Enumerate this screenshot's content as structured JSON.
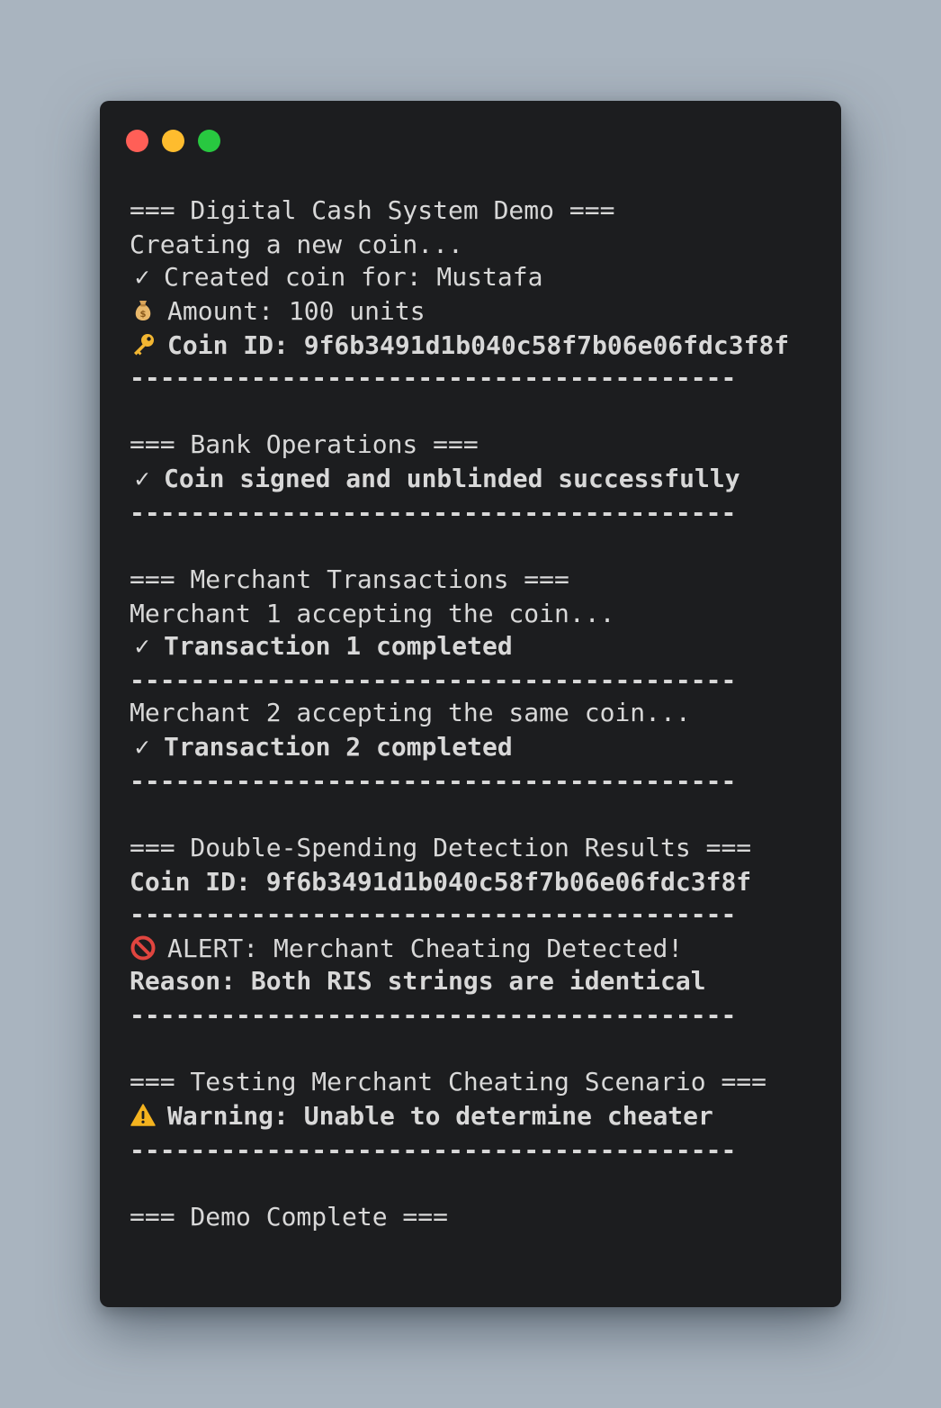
{
  "terminal": {
    "lines": {
      "header_demo": "=== Digital Cash System Demo ===",
      "creating": "Creating a new coin...",
      "created_coin": "Created coin for: Mustafa",
      "amount": "Amount: 100 units",
      "coin_id": "Coin ID: 9f6b3491d1b040c58f7b06e06fdc3f8f",
      "sep1": "----------------------------------------",
      "header_bank": "=== Bank Operations ===",
      "bank_result": "Coin signed and unblinded successfully",
      "sep2": "----------------------------------------",
      "header_merchant": "=== Merchant Transactions ===",
      "merchant1": "Merchant 1 accepting the coin...",
      "tx1": "Transaction 1 completed",
      "sep3": "----------------------------------------",
      "merchant2": "Merchant 2 accepting the same coin...",
      "tx2": "Transaction 2 completed",
      "sep4": "----------------------------------------",
      "header_detection": "=== Double-Spending Detection Results ===",
      "detect_coin_id": "Coin ID: 9f6b3491d1b040c58f7b06e06fdc3f8f",
      "sep5": "----------------------------------------",
      "alert": "ALERT: Merchant Cheating Detected!",
      "reason": "Reason: Both RIS strings are identical",
      "sep6": "----------------------------------------",
      "header_testing": "=== Testing Merchant Cheating Scenario ===",
      "warning": "Warning: Unable to determine cheater",
      "sep7": "----------------------------------------",
      "header_complete": "=== Demo Complete ==="
    },
    "check_glyph": "✓"
  },
  "icons": {
    "amount": "money-bag-icon",
    "coin_id": "key-icon",
    "alert": "prohibited-icon",
    "warning": "warning-icon"
  },
  "colors": {
    "background": "#a9b4bf",
    "terminal_bg": "#1c1d1f",
    "text": "#d8d8d8",
    "close": "#ff5f57",
    "minimize": "#febc2e",
    "maximize": "#28c840"
  }
}
